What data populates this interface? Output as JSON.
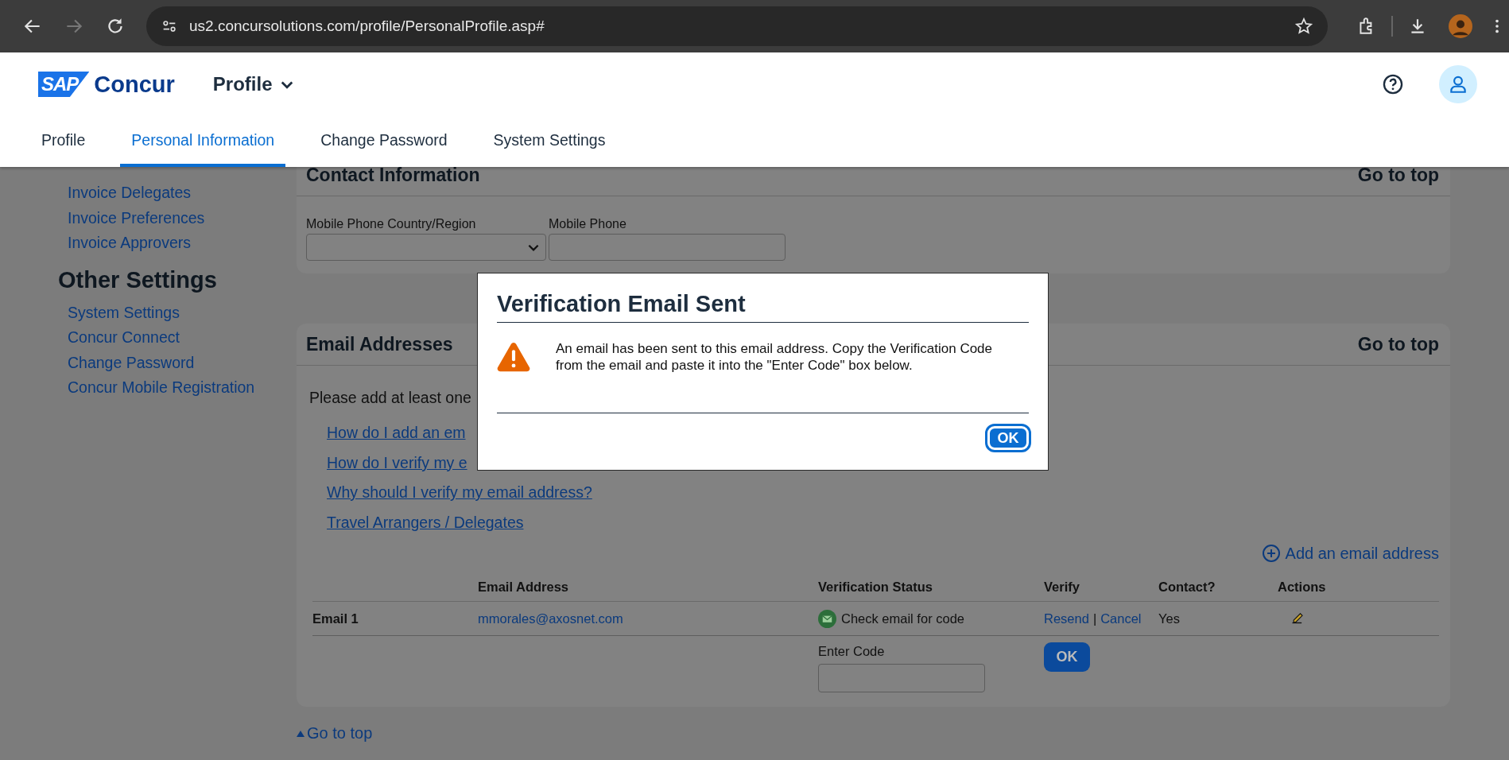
{
  "browser": {
    "url": "us2.concursolutions.com/profile/PersonalProfile.asp#",
    "forward_disabled": true
  },
  "header": {
    "logo_badge": "SAP",
    "logo_text": "Concur",
    "section": "Profile"
  },
  "tabs": [
    {
      "label": "Profile",
      "selected": false
    },
    {
      "label": "Personal Information",
      "selected": true
    },
    {
      "label": "Change Password",
      "selected": false
    },
    {
      "label": "System Settings",
      "selected": false
    }
  ],
  "sidebar": {
    "items_top": [
      "Invoice Delegates",
      "Invoice Preferences",
      "Invoice Approvers"
    ],
    "heading": "Other Settings",
    "items": [
      "System Settings",
      "Concur Connect",
      "Change Password",
      "Concur Mobile Registration"
    ]
  },
  "contact": {
    "title": "Contact Information",
    "go_to_top": "Go to top",
    "fields": [
      {
        "kind": "select",
        "label": "Mobile Phone Country/Region"
      },
      {
        "kind": "text",
        "label": "Mobile Phone"
      }
    ]
  },
  "email": {
    "title": "Email Addresses",
    "go_to_top": "Go to top",
    "intro": "Please add at least one",
    "links": [
      "How do I add an em",
      "How do I verify my e",
      "Why should I verify my email address?",
      "Travel Arrangers / Delegates"
    ],
    "add_link": "Add an email address",
    "columns": [
      "Email Address",
      "Verification Status",
      "Verify",
      "Contact?",
      "Actions"
    ],
    "rows": [
      {
        "label": "Email 1",
        "address": "mmorales@axosnet.com",
        "status": "Check email for code",
        "resend": "Resend",
        "separator": "|",
        "cancel": "Cancel",
        "contact": "Yes"
      }
    ],
    "enter_code_label": "Enter Code",
    "ok_button": "OK"
  },
  "go_to_top": "Go to top",
  "modal": {
    "title": "Verification Email Sent",
    "message": "An email has been sent to this email address. Copy the Verification Code from the email and paste it into the \"Enter Code\" box below.",
    "button": "OK"
  }
}
